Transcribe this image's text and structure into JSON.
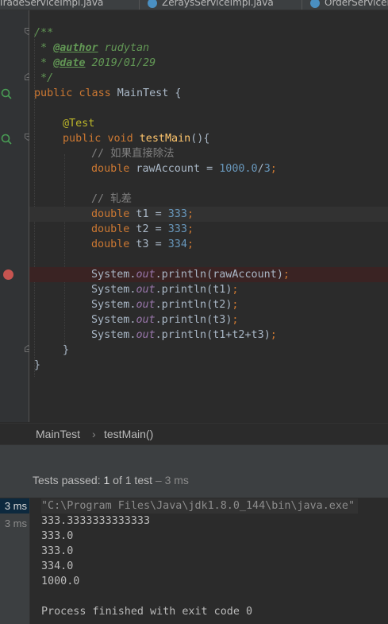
{
  "tabs": [
    {
      "label": "TradeServiceImpl.java"
    },
    {
      "label": "ZeraysServiceImpl.java"
    },
    {
      "label": "OrderServiceImpl.java"
    }
  ],
  "editor": {
    "doc": {
      "open": "/**",
      "author_prefix": " * ",
      "author_tag": "@author",
      "author_value": " rudytan",
      "date_prefix": " * ",
      "date_tag": "@date",
      "date_value": " 2019/01/29",
      "close": " */"
    },
    "class_kw1": "public",
    "class_kw2": "class",
    "class_name": " MainTest {",
    "annotation": "@Test",
    "method_kw1": "public",
    "method_kw2": "void",
    "method_name": "testMain",
    "method_parens": "(){",
    "comment1": "// 如果直接除法",
    "raw_type": "double",
    "raw_var": " rawAccount = ",
    "raw_num1": "1000.0",
    "raw_div": "/",
    "raw_num2": "3",
    "semi": ";",
    "comment2": "// 轧差",
    "decls": [
      {
        "type": "double",
        "name": " t1 = ",
        "value": "333"
      },
      {
        "type": "double",
        "name": " t2 = ",
        "value": "333"
      },
      {
        "type": "double",
        "name": " t3 = ",
        "value": "334"
      }
    ],
    "prints": [
      {
        "cls": "System.",
        "field": "out",
        "call": ".println(",
        "arg": "rawAccount",
        "end": ")",
        "semi": ";"
      },
      {
        "cls": "System.",
        "field": "out",
        "call": ".println(",
        "arg": "t1",
        "end": ")",
        "semi": ";"
      },
      {
        "cls": "System.",
        "field": "out",
        "call": ".println(",
        "arg": "t2",
        "end": ")",
        "semi": ";"
      },
      {
        "cls": "System.",
        "field": "out",
        "call": ".println(",
        "arg": "t3",
        "end": ")",
        "semi": ";"
      },
      {
        "cls": "System.",
        "field": "out",
        "call": ".println(",
        "arg": "t1+t2+t3",
        "end": ")",
        "semi": ";"
      }
    ],
    "close_method": "}",
    "close_class": "}"
  },
  "breadcrumbs": {
    "class": "MainTest",
    "sep": "›",
    "method": "testMain()"
  },
  "test_status": {
    "prefix": "Tests passed: ",
    "count": "1",
    "of": " of 1 test",
    "time": " – 3 ms"
  },
  "test_times": [
    "3 ms",
    "3 ms"
  ],
  "console": {
    "command": "\"C:\\Program Files\\Java\\jdk1.8.0_144\\bin\\java.exe\"",
    "lines": [
      "333.3333333333333",
      "333.0",
      "333.0",
      "334.0",
      "1000.0"
    ],
    "exit": "Process finished with exit code 0"
  },
  "colors": {
    "background": "#2b2b2b",
    "keyword": "#cc7832",
    "number": "#6897bb",
    "doc": "#629755",
    "breakpoint": "#c75450"
  }
}
